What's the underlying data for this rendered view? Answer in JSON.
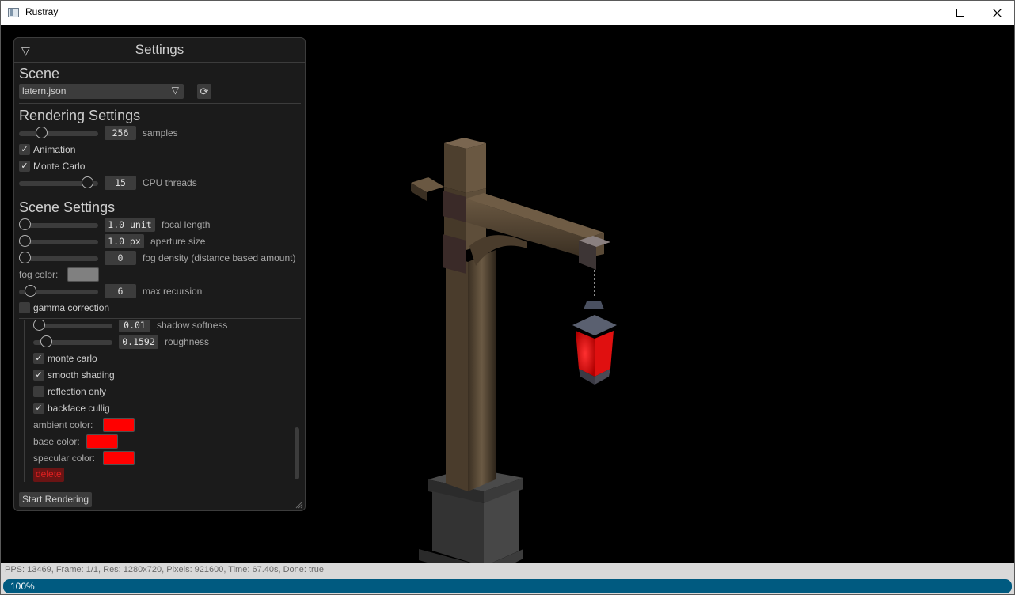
{
  "window": {
    "title": "Rustray"
  },
  "panel": {
    "title": "Settings",
    "scene": {
      "heading": "Scene",
      "file": "latern.json",
      "refresh_icon": "refresh-icon"
    },
    "rendering": {
      "heading": "Rendering Settings",
      "samples": {
        "value": "256",
        "label": "samples"
      },
      "animation": {
        "label": "Animation",
        "checked": true
      },
      "monte_carlo": {
        "label": "Monte Carlo",
        "checked": true
      },
      "cpu_threads": {
        "value": "15",
        "label": "CPU threads"
      }
    },
    "scene_settings": {
      "heading": "Scene Settings",
      "focal_length": {
        "value": "1.0 unit",
        "label": "focal length"
      },
      "aperture_size": {
        "value": "1.0 px",
        "label": "aperture size"
      },
      "fog_density": {
        "value": "0",
        "label": "fog density (distance based amount)"
      },
      "fog_color": {
        "label": "fog color:",
        "color": "#808080"
      },
      "max_recursion": {
        "value": "6",
        "label": "max recursion"
      },
      "gamma_correction": {
        "label": "gamma correction",
        "checked": false
      }
    },
    "material": {
      "shadow_softness": {
        "value": "0.01",
        "label": "shadow softness"
      },
      "roughness": {
        "value": "0.1592",
        "label": "roughness"
      },
      "monte_carlo": {
        "label": "monte carlo",
        "checked": true
      },
      "smooth_shading": {
        "label": "smooth shading",
        "checked": true
      },
      "reflection_only": {
        "label": "reflection only",
        "checked": false
      },
      "backface_culling": {
        "label": "backface cullig",
        "checked": true
      },
      "ambient_color": {
        "label": "ambient color:",
        "color": "#ff0000"
      },
      "base_color": {
        "label": "base color:",
        "color": "#ff0000"
      },
      "specular_color": {
        "label": "specular color:",
        "color": "#ff0000"
      },
      "delete_label": "delete"
    },
    "start_label": "Start Rendering"
  },
  "status": {
    "text": "PPS: 13469, Frame: 1/1, Res: 1280x720, Pixels: 921600, Time: 67.40s, Done: true",
    "progress_text": "100%",
    "progress": 1.0,
    "progress_color": "#005a80"
  }
}
